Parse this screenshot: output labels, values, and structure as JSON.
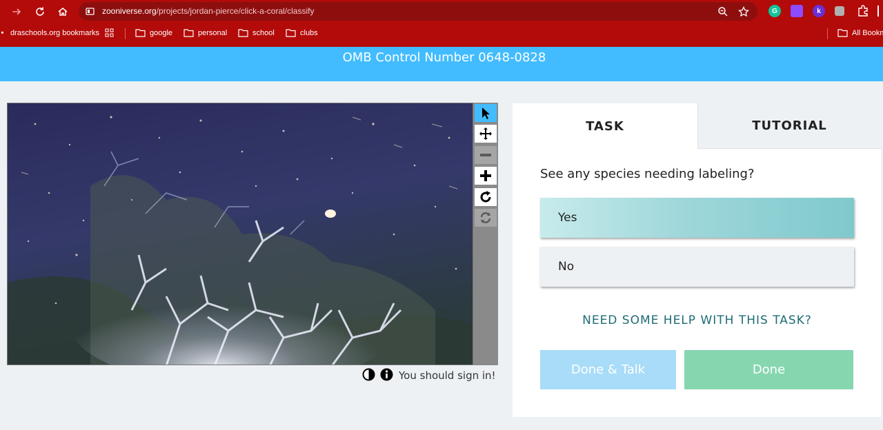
{
  "browser": {
    "url_domain": "zooniverse.org",
    "url_path": "/projects/jordan-pierce/click-a-coral/classify",
    "bookmarks": [
      {
        "label": "draschools.org bookmarks"
      },
      {
        "label": "google"
      },
      {
        "label": "personal"
      },
      {
        "label": "school"
      },
      {
        "label": "clubs"
      },
      {
        "label": "All Bookm"
      }
    ],
    "extensions": [
      "grammarly-icon",
      "extension-purple-icon",
      "extension-k-icon",
      "extension-gray-icon",
      "puzzle-icon"
    ],
    "ext_k_label": "k",
    "colors": {
      "chrome": "#b30a0a",
      "omnibox": "#8e0e0e"
    }
  },
  "banner": {
    "text": "OMB Control Number 0648-0828",
    "color": "#42bcff"
  },
  "viewer": {
    "image_icon": "coral-underwater-image",
    "tools": [
      {
        "name": "pointer-icon",
        "state": "active"
      },
      {
        "name": "move-icon",
        "state": "normal"
      },
      {
        "name": "zoom-out-icon",
        "state": "disabled"
      },
      {
        "name": "zoom-in-icon",
        "state": "normal"
      },
      {
        "name": "rotate-icon",
        "state": "normal"
      },
      {
        "name": "reset-icon",
        "state": "disabled"
      }
    ],
    "signin_text": "You should sign in!"
  },
  "panel": {
    "tabs": [
      {
        "label": "TASK",
        "active": true
      },
      {
        "label": "TUTORIAL",
        "active": false
      }
    ],
    "question": "See any species needing labeling?",
    "answers": [
      {
        "label": "Yes",
        "selected": true
      },
      {
        "label": "No",
        "selected": false
      }
    ],
    "help_text": "NEED SOME HELP WITH THIS TASK?",
    "done_talk_label": "Done & Talk",
    "done_label": "Done",
    "colors": {
      "help": "#1e6b75",
      "done_talk": "#a8dcf8",
      "done": "#86d6b0"
    }
  }
}
